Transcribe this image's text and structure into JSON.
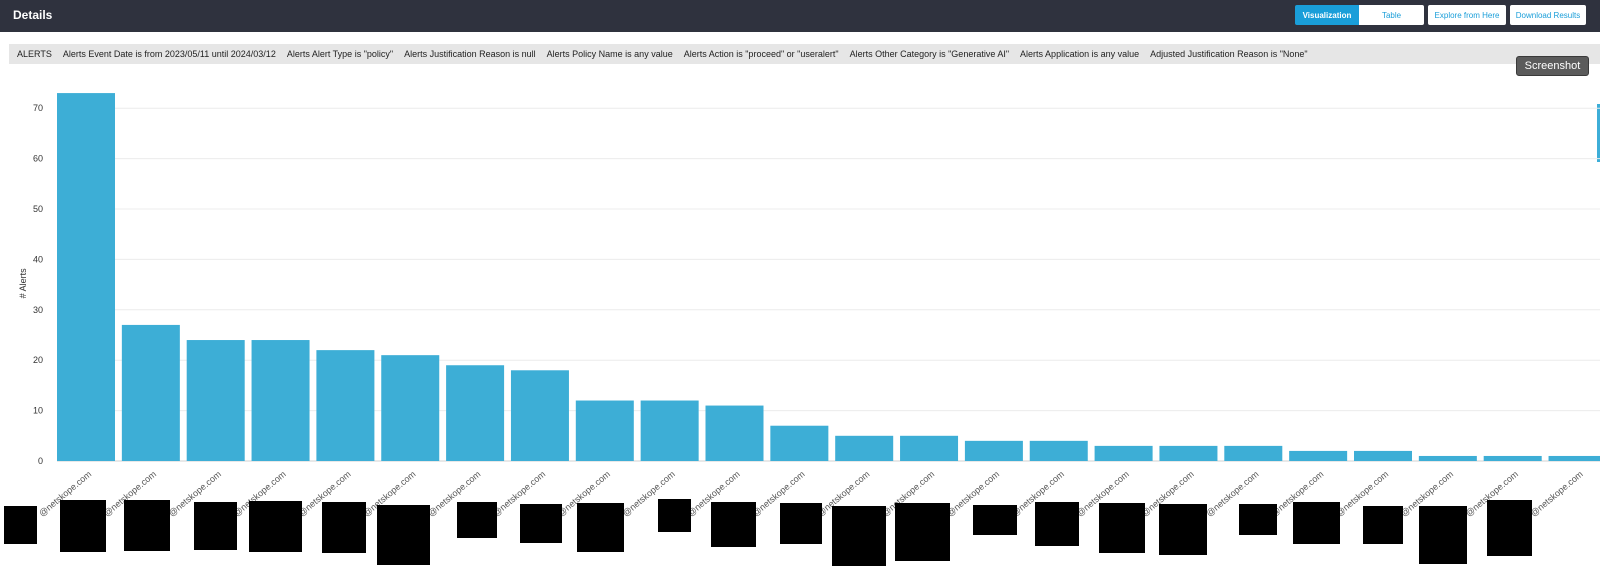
{
  "header": {
    "title": "Details",
    "visualization_label": "Visualization",
    "table_label": "Table",
    "explore_label": "Explore from Here",
    "download_label": "Download Results"
  },
  "filters": [
    "ALERTS",
    "Alerts Event Date is from 2023/05/11 until 2024/03/12",
    "Alerts Alert Type is \"policy\"",
    "Alerts Justification Reason is null",
    "Alerts Policy Name is any value",
    "Alerts Action is \"proceed\" or \"useralert\"",
    "Alerts Other Category is \"Generative AI\"",
    "Alerts Application is any value",
    "Adjusted Justification Reason is \"None\""
  ],
  "screenshot_label": "Screenshot",
  "colors": {
    "accent": "#1a9ed9",
    "bar": "#3daed6",
    "header_bg": "#2f323e",
    "filter_bg": "#e6e6e6",
    "redaction": "#000000"
  },
  "chart_data": {
    "type": "bar",
    "ylabel": "# Alerts",
    "xlabel": "",
    "ylim": [
      0,
      75
    ],
    "yticks": [
      0,
      10,
      20,
      30,
      40,
      50,
      60,
      70
    ],
    "grid": true,
    "categories": [
      "@netskope.com",
      "@netskope.com",
      "@netskope.com",
      "@netskope.com",
      "@netskope.com",
      "@netskope.com",
      "@netskope.com",
      "@netskope.com",
      "@netskope.com",
      "@netskope.com",
      "@netskope.com",
      "@netskope.com",
      "@netskope.com",
      "@netskope.com",
      "@netskope.com",
      "@netskope.com",
      "@netskope.com",
      "@netskope.com",
      "@netskope.com",
      "@netskope.com",
      "@netskope.com",
      "@netskope.com",
      "@netskope.com",
      "@netskope.com"
    ],
    "values": [
      73,
      27,
      24,
      24,
      22,
      21,
      19,
      18,
      12,
      12,
      11,
      7,
      5,
      5,
      4,
      4,
      3,
      3,
      3,
      2,
      2,
      1,
      1,
      1
    ]
  }
}
